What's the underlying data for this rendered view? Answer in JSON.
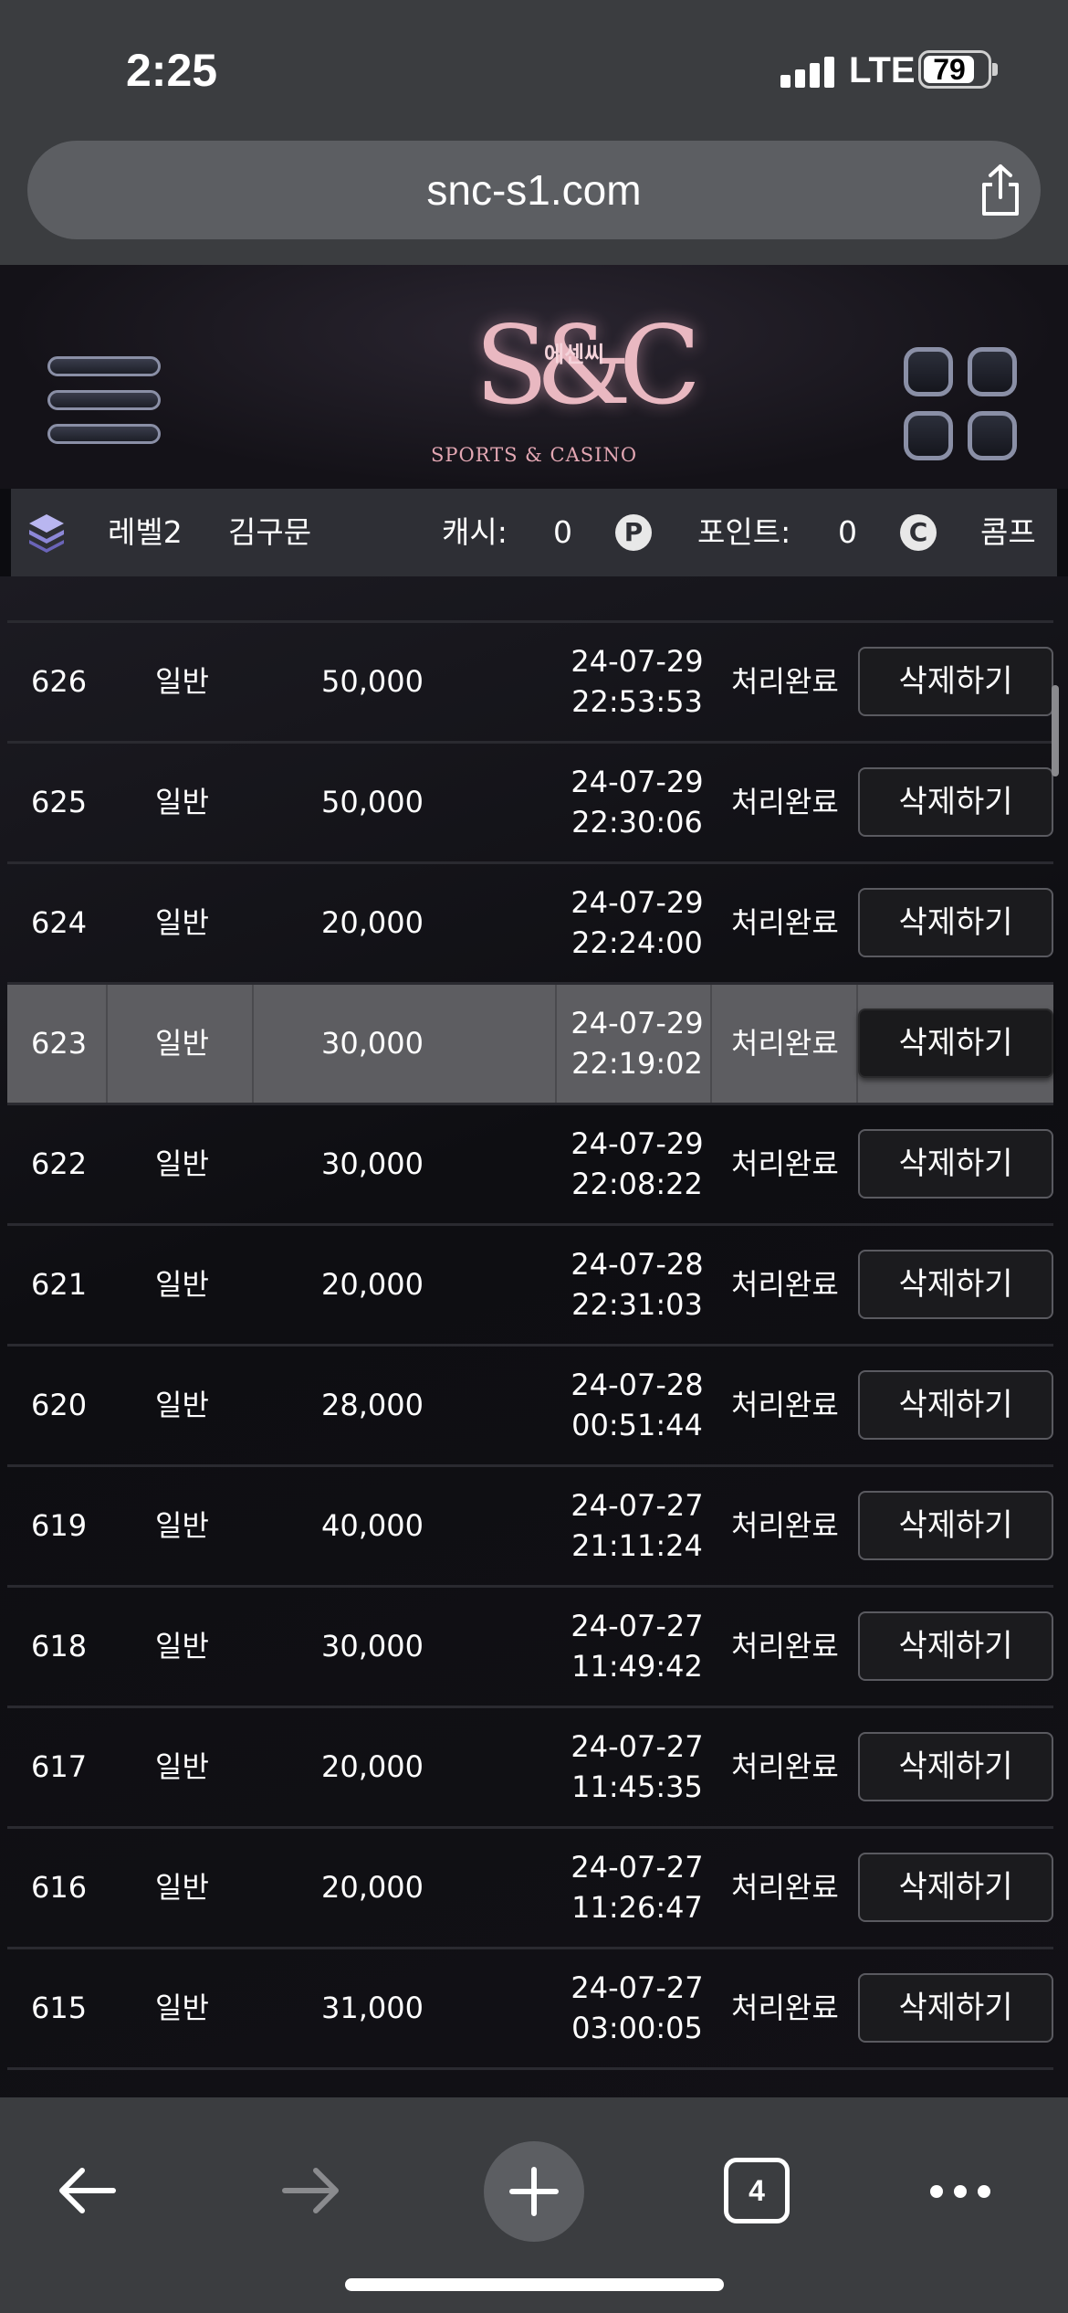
{
  "status_bar": {
    "time": "2:25",
    "network": "LTE",
    "battery": "79",
    "battery_level": 0.79
  },
  "browser": {
    "url": "snc-s1.com",
    "tab_count": "4"
  },
  "site": {
    "logo_mark": "S&C",
    "logo_korean": "에센씨",
    "logo_tagline": "SPORTS & CASINO"
  },
  "info_bar": {
    "level": "레벨2",
    "username": "김구문",
    "cash_label": "캐시:",
    "cash_value": "0",
    "cash_badge": "P",
    "points_label": "포인트:",
    "points_value": "0",
    "points_badge": "C",
    "comp_label": "콤프"
  },
  "table": {
    "rows": [
      {
        "id": "626",
        "type": "일반",
        "amount": "50,000",
        "date": "24-07-29",
        "time": "22:53:53",
        "status": "처리완료",
        "action": "삭제하기"
      },
      {
        "id": "625",
        "type": "일반",
        "amount": "50,000",
        "date": "24-07-29",
        "time": "22:30:06",
        "status": "처리완료",
        "action": "삭제하기"
      },
      {
        "id": "624",
        "type": "일반",
        "amount": "20,000",
        "date": "24-07-29",
        "time": "22:24:00",
        "status": "처리완료",
        "action": "삭제하기"
      },
      {
        "id": "623",
        "type": "일반",
        "amount": "30,000",
        "date": "24-07-29",
        "time": "22:19:02",
        "status": "처리완료",
        "action": "삭제하기",
        "highlighted": true
      },
      {
        "id": "622",
        "type": "일반",
        "amount": "30,000",
        "date": "24-07-29",
        "time": "22:08:22",
        "status": "처리완료",
        "action": "삭제하기"
      },
      {
        "id": "621",
        "type": "일반",
        "amount": "20,000",
        "date": "24-07-28",
        "time": "22:31:03",
        "status": "처리완료",
        "action": "삭제하기"
      },
      {
        "id": "620",
        "type": "일반",
        "amount": "28,000",
        "date": "24-07-28",
        "time": "00:51:44",
        "status": "처리완료",
        "action": "삭제하기"
      },
      {
        "id": "619",
        "type": "일반",
        "amount": "40,000",
        "date": "24-07-27",
        "time": "21:11:24",
        "status": "처리완료",
        "action": "삭제하기"
      },
      {
        "id": "618",
        "type": "일반",
        "amount": "30,000",
        "date": "24-07-27",
        "time": "11:49:42",
        "status": "처리완료",
        "action": "삭제하기"
      },
      {
        "id": "617",
        "type": "일반",
        "amount": "20,000",
        "date": "24-07-27",
        "time": "11:45:35",
        "status": "처리완료",
        "action": "삭제하기"
      },
      {
        "id": "616",
        "type": "일반",
        "amount": "20,000",
        "date": "24-07-27",
        "time": "11:26:47",
        "status": "처리완료",
        "action": "삭제하기"
      },
      {
        "id": "615",
        "type": "일반",
        "amount": "31,000",
        "date": "24-07-27",
        "time": "03:00:05",
        "status": "처리완료",
        "action": "삭제하기"
      }
    ]
  },
  "icons": {
    "menu": "hamburger-icon",
    "grid": "grid-icon",
    "share": "share-icon",
    "back": "back-arrow-icon",
    "forward": "forward-arrow-icon",
    "new_tab": "plus-icon",
    "tabs": "tabs-icon",
    "more": "more-icon"
  },
  "colors": {
    "chrome": "#3b3d40",
    "highlight_row": "#5d5d61",
    "logo_pink": "#e9b8c1"
  }
}
